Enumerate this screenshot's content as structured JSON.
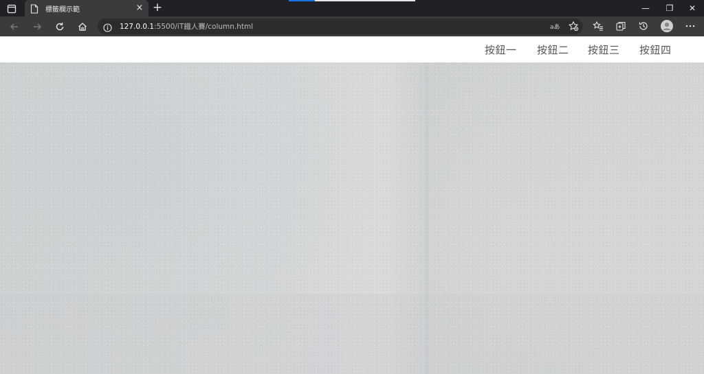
{
  "browser": {
    "tab": {
      "title": "標籤欄示範",
      "close_glyph": "×"
    },
    "new_tab_glyph": "+",
    "address": {
      "host": "127.0.0.1",
      "path": ":5500/iT鐵人賽/column.html"
    },
    "read_aloud_label": "aあ",
    "window_controls": {
      "minimize": "—",
      "restore": "❐",
      "close": "✕"
    },
    "colors": {
      "chrome_dark": "#202124",
      "toolbar": "#3b3b3d",
      "tab_accent_blue": "#1a73e8"
    }
  },
  "page": {
    "nav": {
      "buttons": [
        "按鈕一",
        "按鈕二",
        "按鈕三",
        "按鈕四"
      ]
    },
    "colors": {
      "nav_bg": "#ffffff",
      "nav_text": "#555555",
      "hero_bg": "#d2d4d5"
    }
  }
}
